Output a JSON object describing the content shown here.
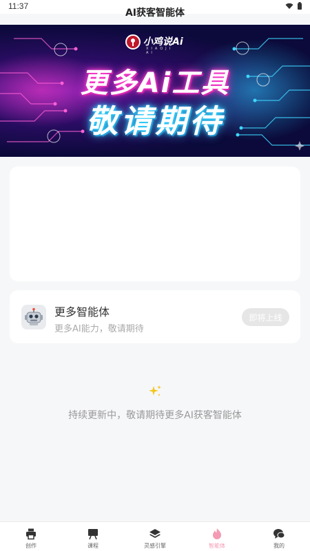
{
  "status": {
    "time": "11:37"
  },
  "header": {
    "title": "AI获客智能体"
  },
  "banner": {
    "brand": "小鸡说Ai",
    "brand_sub": "XIAOJI AI",
    "line1": "更多Ai工具",
    "line2": "敬请期待"
  },
  "agent_card": {
    "icon": "robot-icon",
    "title": "更多智能体",
    "description": "更多AI能力，敬请期待",
    "button": "即将上线"
  },
  "footer_note": "持续更新中，敬请期待更多AI获客智能体",
  "tabs": [
    {
      "label": "创作",
      "icon": "printer-icon"
    },
    {
      "label": "课程",
      "icon": "board-icon"
    },
    {
      "label": "灵感引擎",
      "icon": "layers-icon"
    },
    {
      "label": "智能体",
      "icon": "fire-icon",
      "active": true
    },
    {
      "label": "我的",
      "icon": "chat-icon"
    }
  ],
  "colors": {
    "accent": "#f39ab4",
    "background": "#f6f7f9",
    "card": "#ffffff",
    "disabled_button": "#e6e6e6"
  }
}
